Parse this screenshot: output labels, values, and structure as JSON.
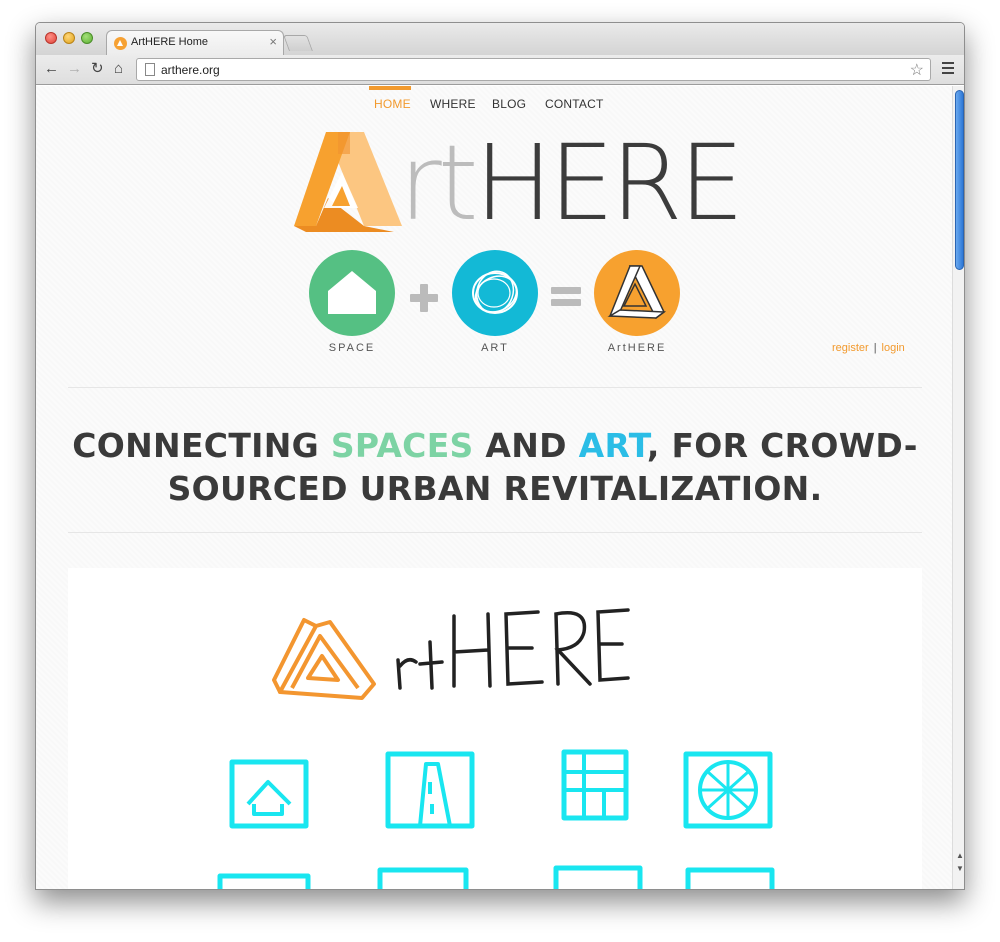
{
  "browser": {
    "tab_title": "ArtHERE Home",
    "tab_close": "×",
    "url": "arthere.org",
    "icons": [
      "back-icon",
      "forward-icon",
      "reload-icon",
      "home-icon",
      "star-icon",
      "menu-icon"
    ]
  },
  "nav": {
    "items": [
      {
        "label": "HOME",
        "active": true
      },
      {
        "label": "WHERE",
        "active": false
      },
      {
        "label": "BLOG",
        "active": false
      },
      {
        "label": "CONTACT",
        "active": false
      }
    ]
  },
  "logo": {
    "text_rt": "rt",
    "text_here": "HERE"
  },
  "equation": {
    "space_label": "SPACE",
    "art_label": "ART",
    "result_label": "ArtHERE",
    "colors": {
      "space": "#55c083",
      "art": "#13b9d6",
      "result": "#f7a12f"
    }
  },
  "auth": {
    "register": "register",
    "separator": "|",
    "login": "login"
  },
  "headline": {
    "part1": "CONNECTING ",
    "spaces": "SPACES",
    "part2": " AND ",
    "art": "ART",
    "part3": ", FOR CROWD-SOURCED URBAN REVITALIZATION."
  },
  "video": {
    "handwritten_logo_rt": "rt",
    "handwritten_logo_here": "HERE"
  },
  "colors": {
    "accent": "#f29a2e",
    "sketch_cyan": "#19e6f0",
    "text_dark": "#3a3a3a"
  }
}
